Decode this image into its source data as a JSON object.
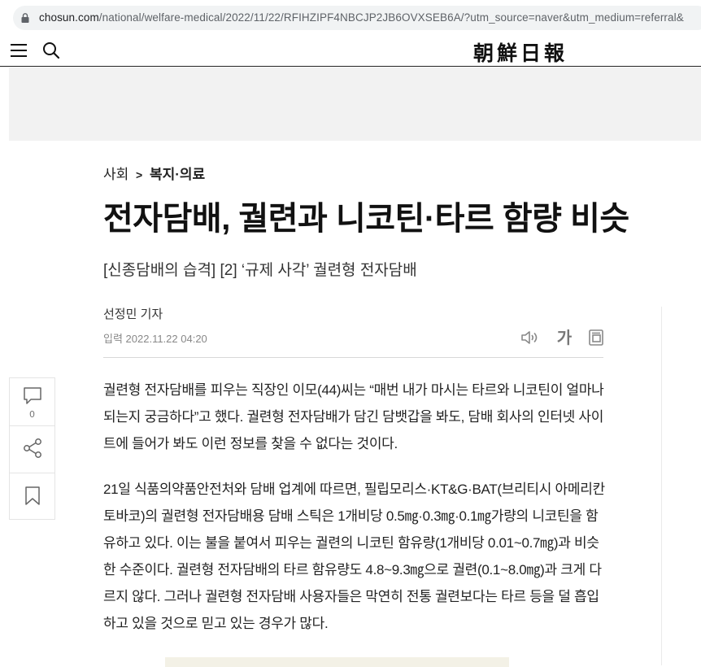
{
  "browser": {
    "url_host": "chosun.com",
    "url_path": "/national/welfare-medical/2022/11/22/RFIHZIPF4NBCJP2JB6OVXSEB6A/?utm_source=naver&utm_medium=referral&"
  },
  "header": {
    "logo": "朝鮮日報"
  },
  "article": {
    "breadcrumb": {
      "section": "사회",
      "separator": ">",
      "subsection": "복지·의료"
    },
    "headline": "전자담배, 궐련과 니코틴·타르 함량 비슷",
    "subtitle": "[신종담배의 습격] [2] ‘규제 사각’ 궐련형 전자담배",
    "author": "선정민 기자",
    "published": "입력 2022.11.22 04:20",
    "tools": {
      "font_label": "가"
    },
    "paragraphs": [
      "궐련형 전자담배를 피우는 직장인 이모(44)씨는 “매번 내가 마시는 타르와 니코틴이 얼마나 되는지 궁금하다”고 했다. 궐련형 전자담배가 담긴 담뱃갑을 봐도, 담배 회사의 인터넷 사이트에 들어가 봐도 이런 정보를 찾을 수 없다는 것이다.",
      "21일 식품의약품안전처와 담배 업계에 따르면, 필립모리스·KT&G·BAT(브리티시 아메리칸 토바코)의 궐련형 전자담배용 담배 스틱은 1개비당 0.5㎎·0.3㎎·0.1㎎가량의 니코틴을 함유하고 있다. 이는 불을 붙여서 피우는 궐련의 니코틴 함유량(1개비당 0.01~0.7㎎)과 비슷한 수준이다. 궐련형 전자담배의 타르 함유량도 4.8~9.3㎎으로 궐련(0.1~8.0㎎)과 크게 다르지 않다. 그러나 궐련형 전자담배 사용자들은 막연히 전통 궐련보다는 타르 등을 덜 흡입하고 있을 것으로 믿고 있는 경우가 많다."
    ]
  },
  "sidebar": {
    "comment_count": "0"
  },
  "colors": {
    "text": "#222222",
    "muted": "#888888",
    "ad_bg": "#f2f2f2"
  }
}
